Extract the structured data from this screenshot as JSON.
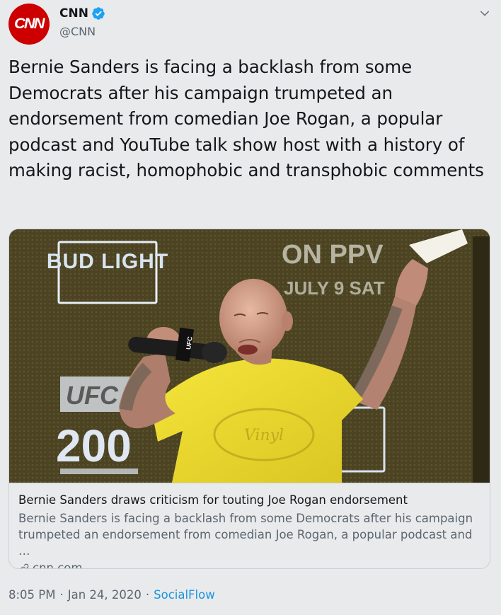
{
  "author": {
    "avatar_text": "CNN",
    "display_name": "CNN",
    "handle": "@CNN",
    "verified": true
  },
  "tweet": {
    "text": "Bernie Sanders is facing a backlash from some Democrats after his campaign trumpeted an endorsement from comedian Joe Rogan, a popular podcast and YouTube talk show host with a history of making racist, homophobic and transphobic comments"
  },
  "card": {
    "image_description_icon": "photo-of-man-with-microphone",
    "image_signage": {
      "bud_light": "BUD LIGHT",
      "on_ppv": "ON PPV",
      "july_date": "JULY 9 SAT",
      "ufc": "UFC",
      "ufc_number": "200",
      "mic_flag": "UFC",
      "shirt_text": "Vinyl"
    },
    "title": "Bernie Sanders draws criticism for touting Joe Rogan endorsement",
    "description": "Bernie Sanders is facing a backlash from some Democrats after his campaign trumpeted an endorsement from comedian Joe Rogan, a popular podcast and …",
    "domain": "cnn.com"
  },
  "footer": {
    "time": "8:05 PM",
    "separator": "·",
    "date": "Jan 24, 2020",
    "separator2": "·",
    "source": "SocialFlow"
  },
  "colors": {
    "background": "#e9eaeb",
    "cnn_red": "#cc0000",
    "verified_blue": "#1da1f2",
    "link_blue": "#1b95e0",
    "secondary_text": "#5b6670",
    "shirt_yellow": "#f2df2e"
  }
}
